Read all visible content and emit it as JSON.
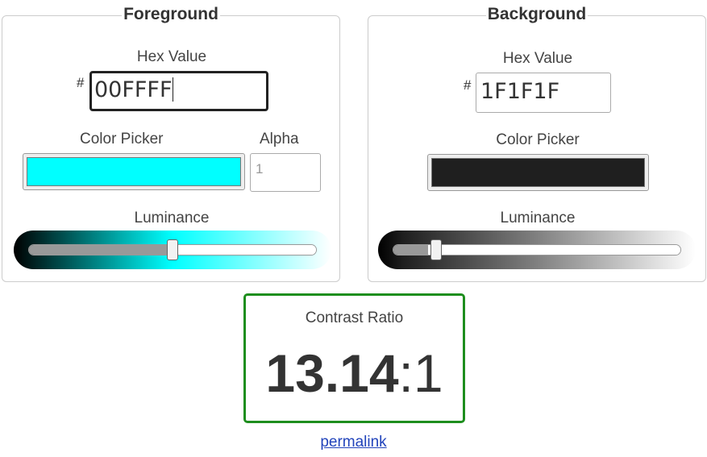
{
  "foreground": {
    "legend": "Foreground",
    "hex_label": "Hex Value",
    "hash": "#",
    "hex_value": "00FFFF",
    "picker_label": "Color Picker",
    "alpha_label": "Alpha",
    "alpha_placeholder": "1",
    "luminance_label": "Luminance",
    "swatch_color": "#00FFFF",
    "luminance_level": 0.5
  },
  "background": {
    "legend": "Background",
    "hex_label": "Hex Value",
    "hash": "#",
    "hex_value": "1F1F1F",
    "picker_label": "Color Picker",
    "luminance_label": "Luminance",
    "swatch_color": "#1F1F1F",
    "luminance_level": 0.12
  },
  "contrast": {
    "label": "Contrast Ratio",
    "value": "13.14",
    "separator": ":",
    "denominator": "1",
    "border_color": "#1E8E1E"
  },
  "permalink": {
    "label": "permalink"
  }
}
